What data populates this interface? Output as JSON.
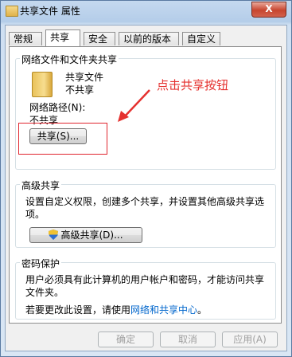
{
  "window": {
    "title": "共享文件 属性",
    "close_label": "X"
  },
  "tabs": [
    {
      "label": "常规"
    },
    {
      "label": "共享"
    },
    {
      "label": "安全"
    },
    {
      "label": "以前的版本"
    },
    {
      "label": "自定义"
    }
  ],
  "network_sharing": {
    "title": "网络文件和文件夹共享",
    "folder_name": "共享文件",
    "status": "不共享",
    "path_label": "网络路径(N):",
    "path_value": "不共享",
    "share_button": "共享(S)..."
  },
  "advanced_sharing": {
    "title": "高级共享",
    "description_line1": "设置自定义权限，创建多个共享，并设置其他高级共享选",
    "description_line2": "项。",
    "button": "高级共享(D)..."
  },
  "password_protection": {
    "title": "密码保护",
    "description_line1": "用户必须具有此计算机的用户帐户和密码，才能访问共享",
    "description_line2": "文件夹。",
    "change_prefix": "若要更改此设置，请使用",
    "link": "网络和共享中心",
    "change_suffix": "。"
  },
  "footer": {
    "ok": "确定",
    "cancel": "取消",
    "apply": "应用(A)"
  },
  "annotation": {
    "text": "点击共享按钮",
    "color": "#e5312f"
  }
}
